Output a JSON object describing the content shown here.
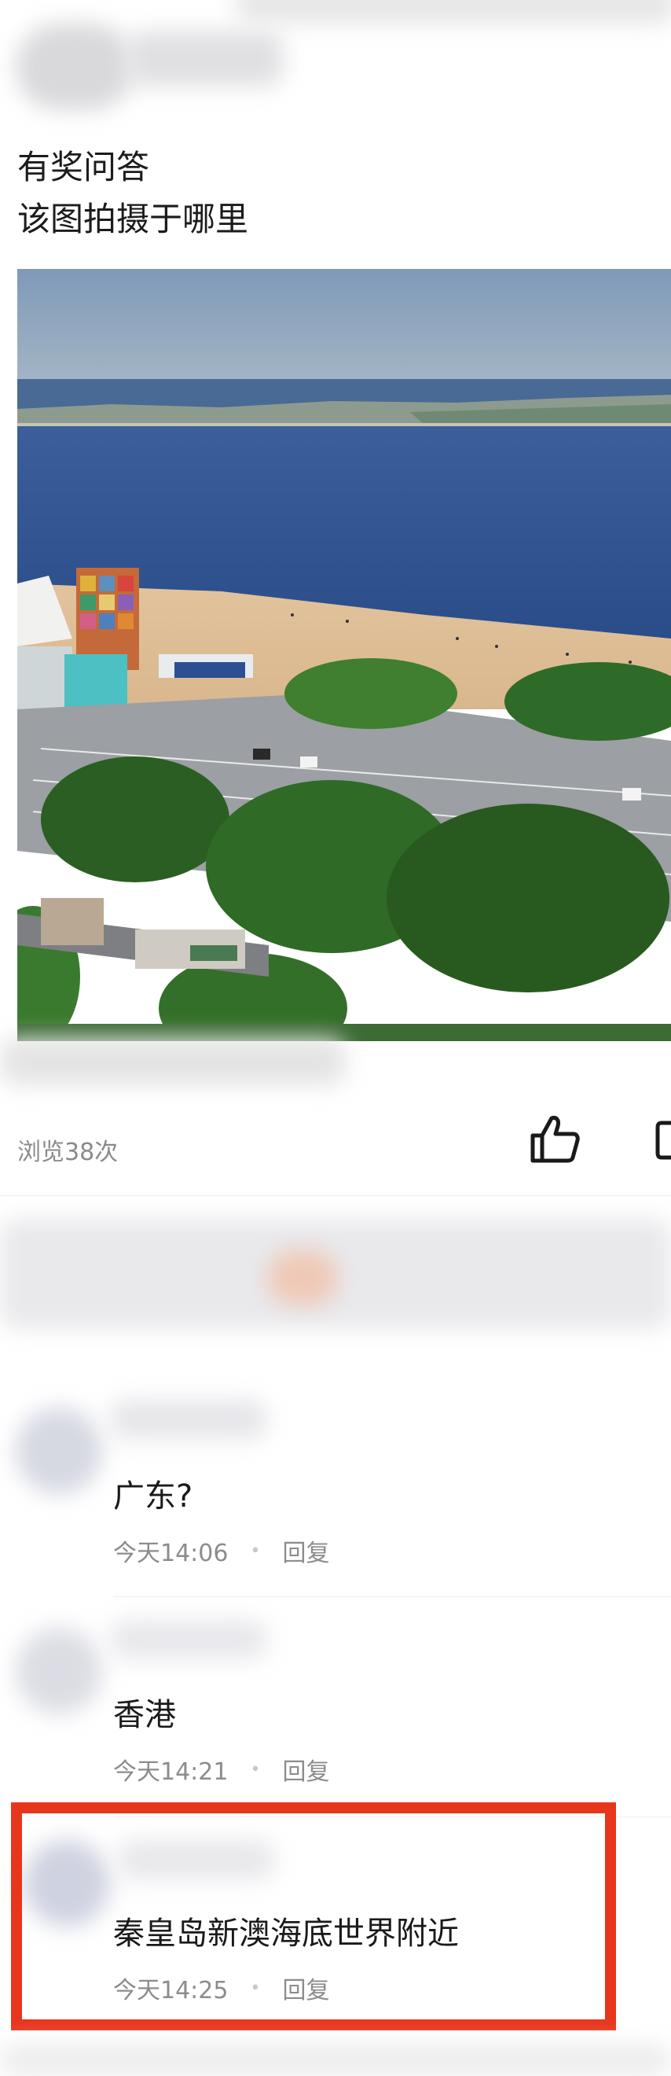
{
  "post": {
    "line1": "有奖问答",
    "line2": "该图拍摄于哪里",
    "photo_description": "",
    "views": "浏览38次"
  },
  "icons": {
    "like": "thumbs-up-icon",
    "comment": "comment-icon"
  },
  "comments": [
    {
      "text": "广东?",
      "time": "今天14:06",
      "reply": "回复"
    },
    {
      "text": "香港",
      "time": "今天14:21",
      "reply": "回复"
    },
    {
      "text": "秦皇岛新澳海底世界附近",
      "time": "今天14:25",
      "reply": "回复"
    }
  ],
  "colors": {
    "highlight": "#e8361d",
    "meta_text": "#8c8c8c"
  }
}
